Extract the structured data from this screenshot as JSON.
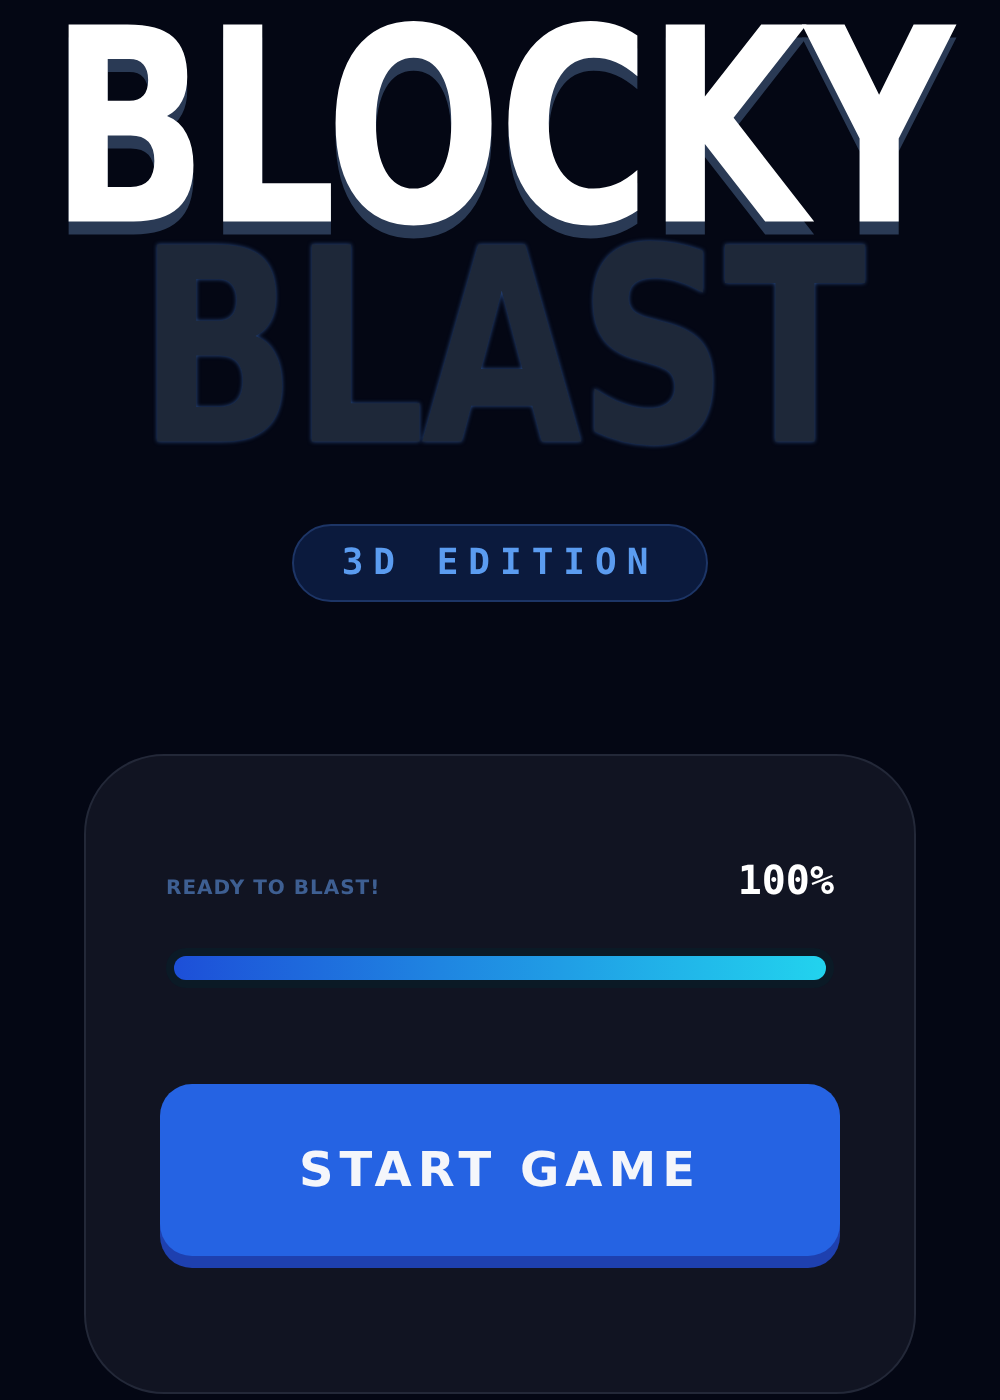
{
  "title": {
    "lines": [
      "BLOCKY",
      "BLAST"
    ]
  },
  "badge": "3D EDITION",
  "loader": {
    "label": "READY TO BLAST!",
    "percent": "100%",
    "level": 1
  },
  "buttons": [
    "START GAME"
  ]
}
